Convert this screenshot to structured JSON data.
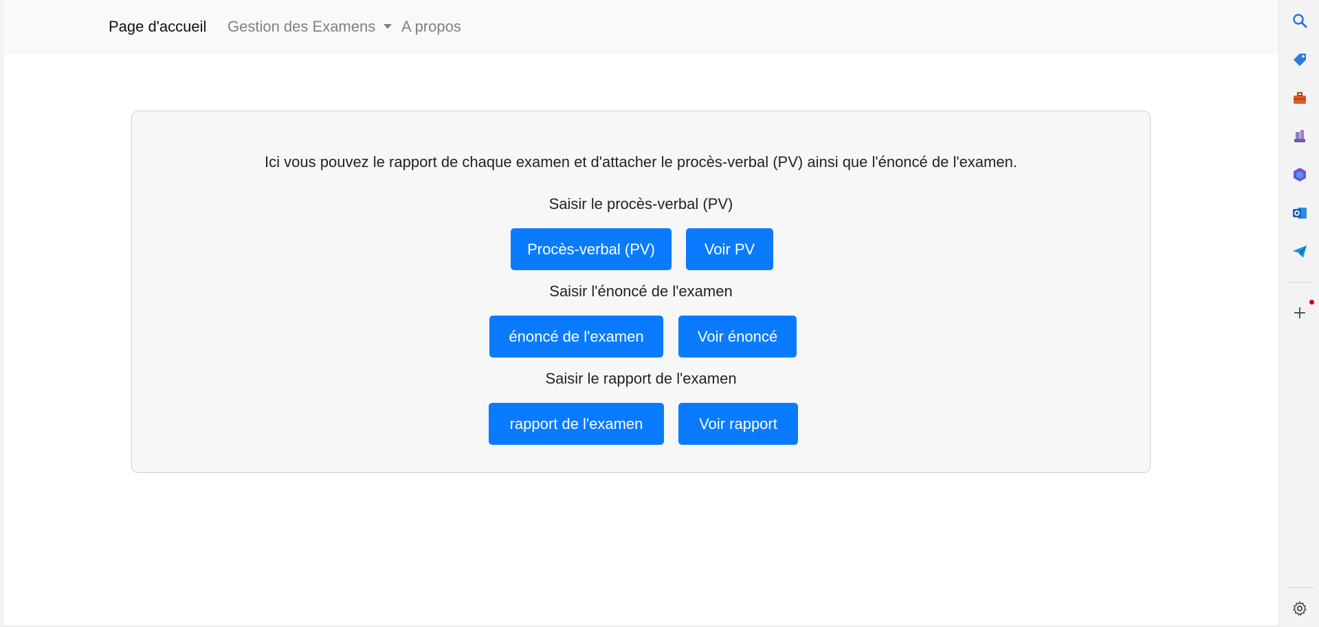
{
  "navbar": {
    "home_label": "Page d'accueil",
    "exams_label": "Gestion des Examens",
    "about_label": "A propos"
  },
  "card": {
    "intro": "Ici vous pouvez le rapport de chaque examen et d'attacher le procès-verbal (PV) ainsi que l'énoncé de l'examen.",
    "pv": {
      "heading": "Saisir le procès-verbal (PV)",
      "add_label": "Procès-verbal (PV)",
      "view_label": "Voir PV"
    },
    "enonce": {
      "heading": "Saisir l'énoncé de l'examen",
      "add_label": "énoncé de l'examen",
      "view_label": "Voir énoncé"
    },
    "rapport": {
      "heading": "Saisir le rapport de l'examen",
      "add_label": "rapport de l'examen",
      "view_label": "Voir rapport"
    }
  },
  "sidebar": {
    "icons": [
      "search-icon",
      "tag-icon",
      "toolbox-icon",
      "chess-icon",
      "office-icon",
      "outlook-icon",
      "send-icon",
      "add-icon",
      "settings-icon"
    ]
  },
  "colors": {
    "primary_button": "#0a7bff",
    "navbar_bg": "#f8f9fa",
    "card_bg": "#f7f7f7"
  }
}
